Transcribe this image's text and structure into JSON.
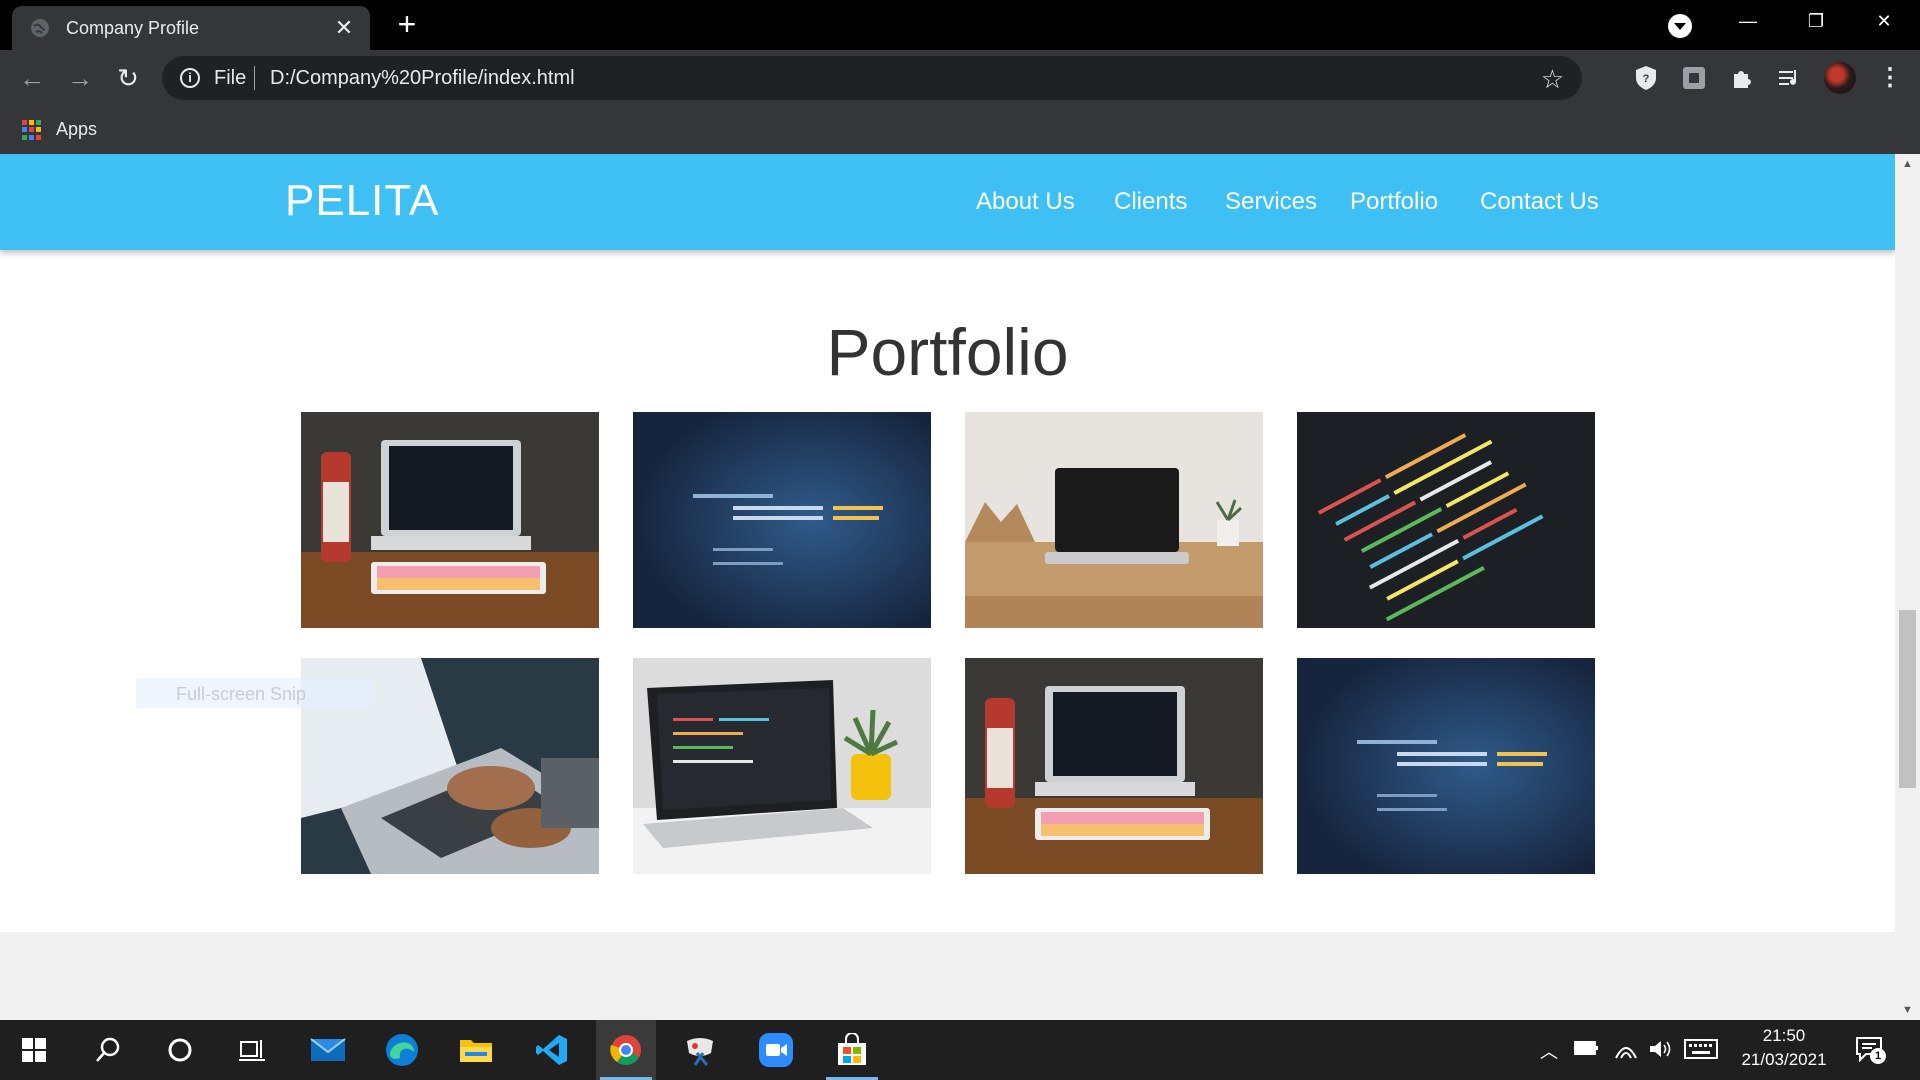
{
  "browser": {
    "tab_title": "Company Profile",
    "tab_close": "✕",
    "new_tab": "+",
    "scheme": "File",
    "url": "D:/Company%20Profile/index.html",
    "bookmarks": [
      {
        "label": "Apps"
      }
    ],
    "window_controls": {
      "minimize": "—",
      "restore": "❐",
      "close": "✕"
    }
  },
  "site": {
    "brand": "PELITA",
    "nav": [
      {
        "label": "About Us"
      },
      {
        "label": "Clients"
      },
      {
        "label": "Services"
      },
      {
        "label": "Portfolio"
      },
      {
        "label": "Contact Us"
      }
    ],
    "section_title": "Portfolio",
    "gallery": [
      {
        "alt": "laptop-with-colorful-keyboard"
      },
      {
        "alt": "blue-code-screen"
      },
      {
        "alt": "laptop-on-wooden-desk"
      },
      {
        "alt": "code-editor-closeup"
      },
      {
        "alt": "hands-typing-on-laptop"
      },
      {
        "alt": "laptop-with-code-and-plant"
      },
      {
        "alt": "laptop-with-colorful-keyboard"
      },
      {
        "alt": "blue-code-screen"
      }
    ],
    "snip_overlay": "Full-screen Snip"
  },
  "taskbar": {
    "time": "21:50",
    "date": "21/03/2021",
    "notification_count": "1"
  },
  "colors": {
    "navbar": "#3ec0f5",
    "chrome_dark": "#35363a",
    "taskbar": "#1f1f1f"
  }
}
